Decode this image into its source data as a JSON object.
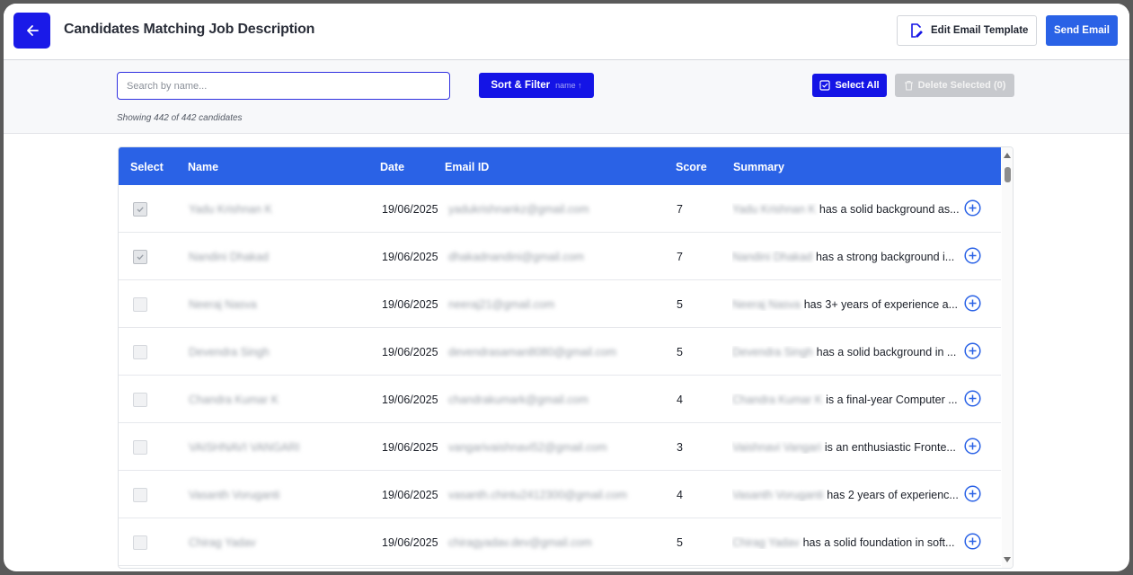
{
  "header": {
    "title": "Candidates Matching Job Description",
    "edit_template_label": "Edit Email Template",
    "send_email_label": "Send Email"
  },
  "toolbar": {
    "search_placeholder": "Search by name...",
    "sort_label": "Sort & Filter",
    "sort_meta": "name ↑",
    "showing_text": "Showing 442 of 442 candidates",
    "select_all_label": "Select All",
    "delete_label": "Delete Selected (0)"
  },
  "table": {
    "columns": [
      "Select",
      "Name",
      "Date",
      "Email ID",
      "Score",
      "Summary"
    ],
    "rows": [
      {
        "checked": true,
        "name": "Yadu Krishnan K",
        "date": "19/06/2025",
        "email": "yadukrishnankz@gmail.com",
        "score": "7",
        "summary_name": "Yadu Krishnan K",
        "summary": "has a solid background as..."
      },
      {
        "checked": true,
        "name": "Nandini Dhakad",
        "date": "19/06/2025",
        "email": "dhakadnandini@gmail.com",
        "score": "7",
        "summary_name": "Nandini Dhakad",
        "summary": "has a strong background i..."
      },
      {
        "checked": false,
        "name": "Neeraj Nasva",
        "date": "19/06/2025",
        "email": "neeraj21@gmail.com",
        "score": "5",
        "summary_name": "Neeraj Nasva",
        "summary": "has 3+ years of experience a..."
      },
      {
        "checked": false,
        "name": "Devendra Singh",
        "date": "19/06/2025",
        "email": "devendrasaman8080@gmail.com",
        "score": "5",
        "summary_name": "Devendra Singh",
        "summary": "has a solid background in ..."
      },
      {
        "checked": false,
        "name": "Chandra Kumar K",
        "date": "19/06/2025",
        "email": "chandrakumark@gmail.com",
        "score": "4",
        "summary_name": "Chandra Kumar K",
        "summary": "is a final-year Computer ..."
      },
      {
        "checked": false,
        "name": "VAISHNAVI VANGARI",
        "date": "19/06/2025",
        "email": "vangarivaishnavi52@gmail.com",
        "score": "3",
        "summary_name": "Vaishnavi Vangari",
        "summary": "is an enthusiastic Fronte..."
      },
      {
        "checked": false,
        "name": "Vasanth Voruganti",
        "date": "19/06/2025",
        "email": "vasanth.chintu2412300@gmail.com",
        "score": "4",
        "summary_name": "Vasanth Voruganti",
        "summary": "has 2 years of experienc..."
      },
      {
        "checked": false,
        "name": "Chirag Yadav",
        "date": "19/06/2025",
        "email": "chiragyadav.dev@gmail.com",
        "score": "5",
        "summary_name": "Chirag Yadav",
        "summary": "has a solid foundation in soft..."
      }
    ]
  },
  "colors": {
    "primary": "#1414e6",
    "table_header": "#2a62e6",
    "disabled": "#c7c9cd"
  }
}
